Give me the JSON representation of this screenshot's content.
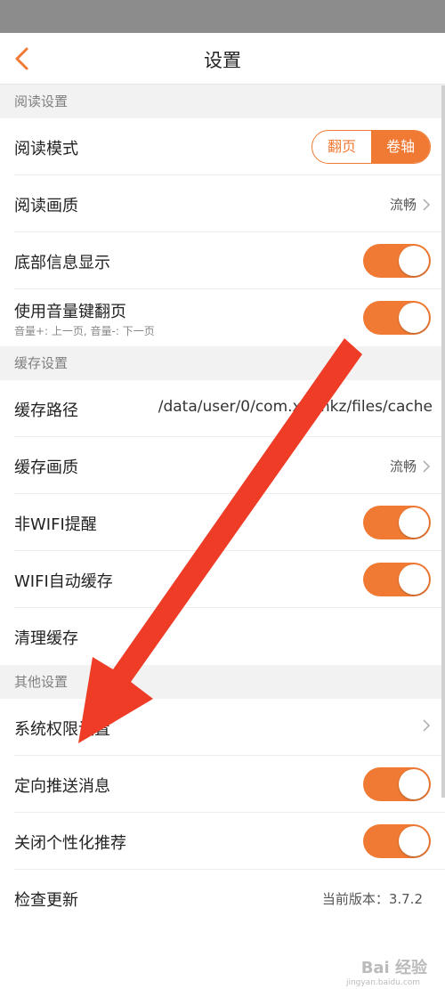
{
  "header": {
    "title": "设置"
  },
  "sections": {
    "reading": {
      "title": "阅读设置"
    },
    "cache": {
      "title": "缓存设置"
    },
    "other": {
      "title": "其他设置"
    }
  },
  "rows": {
    "read_mode": {
      "label": "阅读模式",
      "options": [
        "翻页",
        "卷轴"
      ],
      "selected": "卷轴"
    },
    "read_quality": {
      "label": "阅读画质",
      "value": "流畅"
    },
    "bottom_info": {
      "label": "底部信息显示",
      "on": true
    },
    "volume_key": {
      "label": "使用音量键翻页",
      "sub": "音量+: 上一页, 音量-: 下一页",
      "on": true
    },
    "cache_path": {
      "label": "缓存路径",
      "value": "/data/user/0/com.x   j.mkz/files/cache"
    },
    "cache_quality": {
      "label": "缓存画质",
      "value": "流畅"
    },
    "non_wifi_alert": {
      "label": "非WIFI提醒",
      "on": true
    },
    "wifi_auto_cache": {
      "label": "WIFI自动缓存",
      "on": true
    },
    "clear_cache": {
      "label": "清理缓存"
    },
    "system_permission": {
      "label": "系统权限设置"
    },
    "targeted_push": {
      "label": "定向推送消息",
      "on": true
    },
    "close_personalized": {
      "label": "关闭个性化推荐",
      "on": true
    },
    "check_update": {
      "label": "检查更新",
      "value": "当前版本：3.7.2"
    }
  },
  "watermark": {
    "text": "Bai 经验",
    "url": "jingyan.baidu.com"
  },
  "colors": {
    "accent": "#f07a33",
    "arrow": "#ee3c26"
  }
}
